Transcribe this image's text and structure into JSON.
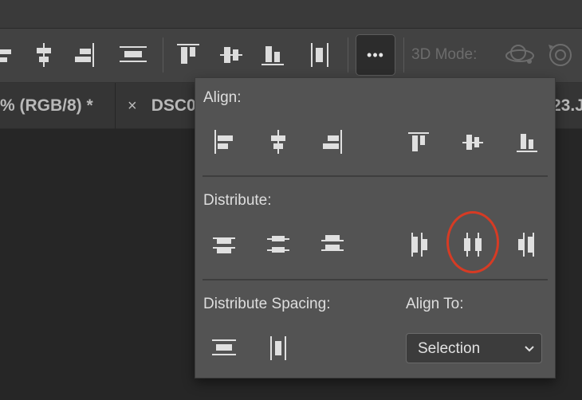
{
  "options_bar": {
    "more_label": "•••",
    "mode_label": "3D Mode:"
  },
  "tabs": [
    {
      "label": "% (RGB/8) *"
    },
    {
      "close": "×",
      "label": "DSC0"
    },
    {
      "label": "23.J"
    }
  ],
  "panel": {
    "align_label": "Align:",
    "distribute_label": "Distribute:",
    "distribute_spacing_label": "Distribute Spacing:",
    "align_to_label": "Align To:",
    "align_to_value": "Selection"
  },
  "colors": {
    "highlight": "#d63b24",
    "panel_bg": "#535353",
    "icon": "#e0e0e0"
  }
}
